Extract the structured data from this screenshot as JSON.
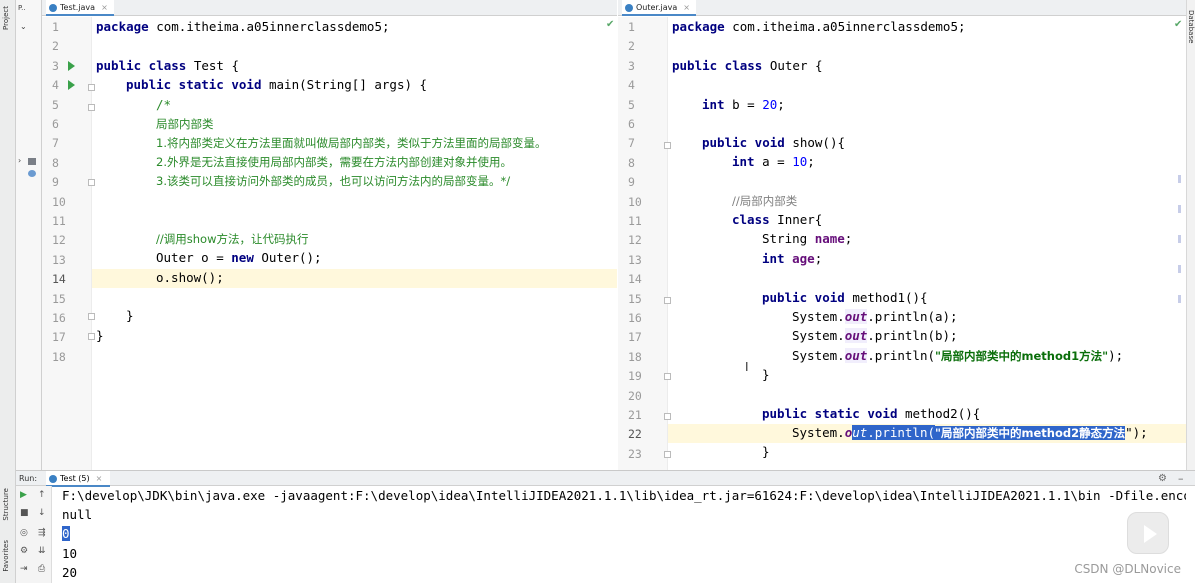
{
  "project_tool": {
    "label": "Project",
    "tree": [
      "P..",
      "c",
      "m",
      "S"
    ]
  },
  "right_tool": {
    "label": "Database"
  },
  "left_editor": {
    "tab": "Test.java",
    "lines": [
      "1",
      "2",
      "3",
      "4",
      "5",
      "6",
      "7",
      "8",
      "9",
      "10",
      "11",
      "12",
      "13",
      "14",
      "15",
      "16",
      "17",
      "18"
    ]
  },
  "right_editor": {
    "tab": "Outer.java",
    "lines": [
      "1",
      "2",
      "3",
      "4",
      "5",
      "6",
      "7",
      "8",
      "9",
      "10",
      "11",
      "12",
      "13",
      "14",
      "15",
      "16",
      "17",
      "18",
      "19",
      "20",
      "21",
      "22",
      "23"
    ]
  },
  "code": {
    "t_package": "package",
    "t_pkg": " com.itheima.a05innerclassdemo5;",
    "t_public": "public",
    "t_class": " class",
    "t_test": " Test {",
    "t_public2": "public",
    "t_static": " static",
    "t_void": " void",
    "t_main": " main(String[] args) {",
    "t_c1": "/*",
    "t_c2": "局部内部类",
    "t_c3": "1.将内部类定义在方法里面就叫做局部内部类，类似于方法里面的局部变量。",
    "t_c4": "2.外界是无法直接使用局部内部类，需要在方法内部创建对象并使用。",
    "t_c5": "3.该类可以直接访问外部类的成员，也可以访问方法内的局部变量。*/",
    "t_c6": "//调用show方法，让代码执行",
    "t_outer1": "Outer o = ",
    "t_new": "new",
    "t_outer2": " Outer();",
    "t_show": "o.show();",
    "t_brace": "}",
    "o_package": "package",
    "o_pkg": " com.itheima.a05innerclassdemo5;",
    "o_public": "public",
    "o_class": " class",
    "o_outer": " Outer {",
    "o_int": "int",
    "o_b": " b = ",
    "o_20": "20",
    "o_semi": ";",
    "o_public2": "public",
    "o_void": " void",
    "o_show": " show(){",
    "o_int2": "int",
    "o_a": " a = ",
    "o_10": "10",
    "o_cm": "//局部内部类",
    "o_class2": "class",
    "o_inner": " Inner{",
    "o_string": "String ",
    "o_name": "name",
    "o_int3": "int",
    "o_age": "age",
    "o_public3": "public",
    "o_void2": " void",
    "o_m1": " method1(){",
    "o_sys": "System.",
    "o_out": "out",
    "o_pa": ".println(a);",
    "o_pb": ".println(b);",
    "o_pc1": ".println(",
    "o_str1": "\"局部内部类中的method1方法\"",
    "o_pc2": ");",
    "o_close": "}",
    "o_public4": "public",
    "o_static": " static",
    "o_void3": " void",
    "o_m2": " method2(){",
    "o_sys2": "System.",
    "o_o": "o",
    "o_ut": "ut",
    "o_sel2": ".println(",
    "o_str2": "\"局部内部类中的method2静态方法",
    "o_tail": "\");"
  },
  "run_panel": {
    "label": "Run:",
    "tab": "Test (5)"
  },
  "console": {
    "cmd": "F:\\develop\\JDK\\bin\\java.exe -javaagent:F:\\develop\\idea\\IntelliJIDEA2021.1.1\\lib\\idea_rt.jar=61624:F:\\develop\\idea\\IntelliJIDEA2021.1.1\\bin -Dfile.enco",
    "out": [
      "null",
      "0",
      "10",
      "20"
    ]
  },
  "side_tabs": {
    "structure": "Structure",
    "favorites": "Favorites"
  },
  "watermark": "CSDN @DLNovice"
}
